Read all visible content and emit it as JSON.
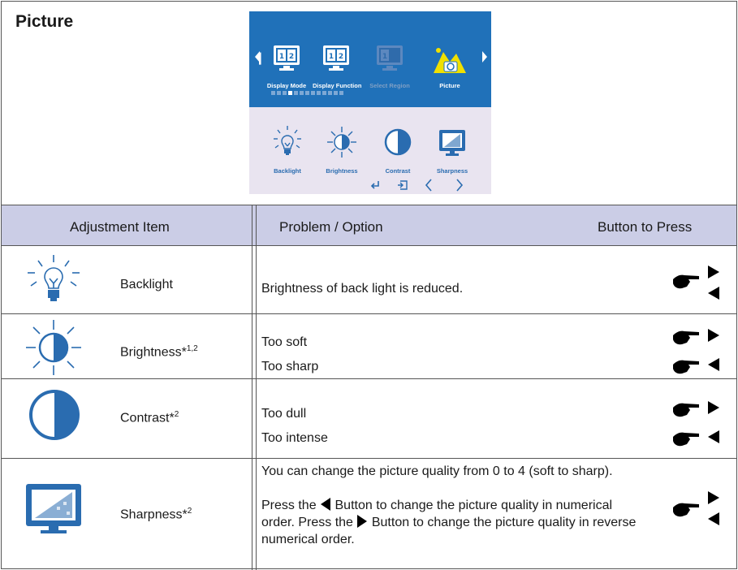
{
  "section_title": "Picture",
  "osd": {
    "top_items": [
      {
        "label": "Display Mode",
        "icon": "display-mode-icon",
        "digits": "1 2"
      },
      {
        "label": "Display Function",
        "icon": "display-function-icon",
        "digits": "1 2"
      },
      {
        "label": "Select Region",
        "icon": "select-region-icon",
        "digits": "1"
      },
      {
        "label": "Picture",
        "icon": "picture-icon"
      }
    ],
    "sub_items": [
      {
        "label": "Backlight",
        "icon": "backlight-icon"
      },
      {
        "label": "Brightness",
        "icon": "brightness-icon"
      },
      {
        "label": "Contrast",
        "icon": "contrast-icon"
      },
      {
        "label": "Sharpness",
        "icon": "sharpness-icon"
      }
    ],
    "nav_icons": [
      "enter-icon",
      "exit-icon",
      "left-chevron-icon",
      "right-chevron-icon"
    ],
    "colors": {
      "top": "#2071b9",
      "bottom": "#e9e4f0",
      "picture_icon": "#f0e000",
      "label_blue": "#2a6cb0"
    }
  },
  "table": {
    "headers": {
      "item": "Adjustment Item",
      "problem": "Problem / Option",
      "button": "Button to Press"
    },
    "header_bg": "#cbcde6",
    "rows": [
      {
        "name": "Backlight",
        "sup": "",
        "lines": [
          "Brightness of back light is reduced."
        ],
        "buttons": "pair"
      },
      {
        "name": "Brightness*",
        "sup": "1,2",
        "lines": [
          "Too soft",
          "Too sharp"
        ],
        "buttons": "separate"
      },
      {
        "name": "Contrast*",
        "sup": "2",
        "lines": [
          "Too dull",
          "Too intense"
        ],
        "buttons": "separate"
      },
      {
        "name": "Sharpness*",
        "sup": "2",
        "para1": "You can change the picture quality from 0 to 4 (soft to sharp).",
        "para2a": "Press the",
        "para2b": "Button to change the picture quality in numerical order. Press the",
        "para2c": "Button to change the picture quality in reverse numerical order.",
        "buttons": "pair"
      }
    ]
  }
}
